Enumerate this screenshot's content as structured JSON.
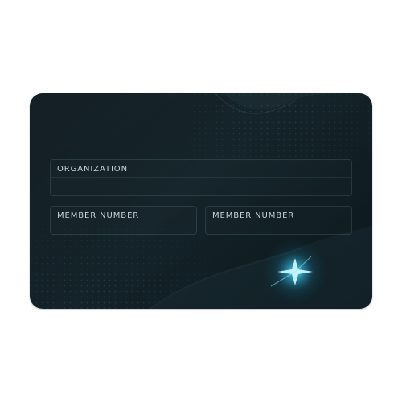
{
  "card": {
    "colors": {
      "background": "#0d1b20",
      "accent_glow": "#3fd4ff",
      "label_text": "#c8d4d8"
    },
    "fields": {
      "organization": {
        "label": "ORGANIZATION",
        "value": ""
      },
      "member_number_1": {
        "label": "MEMBER NUMBER",
        "value": ""
      },
      "member_number_2": {
        "label": "MEMBER NUMBER",
        "value": ""
      }
    },
    "decorations": {
      "glow": "star-glow-icon",
      "pattern": "dot-grid-pattern"
    }
  }
}
